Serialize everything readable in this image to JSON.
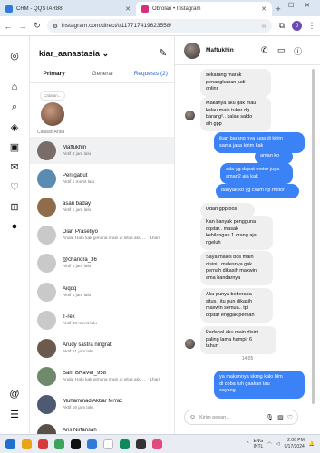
{
  "browser": {
    "tabs": [
      {
        "title": "CRM - QQSTAR88",
        "favicon_color": "#2f7bd9",
        "active": false
      },
      {
        "title": "Obrolan • Instagram",
        "favicon_color": "#d6307a",
        "active": true
      }
    ],
    "url": "instagram.com/direct/t/117717419623558/",
    "profile_initial": "J"
  },
  "inbox": {
    "username": "kiar_aanastasia",
    "tabs": {
      "primary": "Primary",
      "general": "General",
      "requests": "Requests (2)"
    },
    "note_bubble": "Catatan...",
    "note_label": "Catatan Anda",
    "conversations": [
      {
        "name": "Maftukhin",
        "status": "Aktif 4 jam lalu",
        "color": "#7a6d68",
        "active": true
      },
      {
        "name": "Peri gabut",
        "status": "Aktif 1 menit lalu",
        "color": "#5a8bb0"
      },
      {
        "name": "asan baday",
        "status": "Aktif 1 jam lalu",
        "color": "#8f6d4a"
      },
      {
        "name": "Dian Prasetiyo",
        "status": "Anda: Halo kak gimana main di situs aku ... · 1hari",
        "color": "#c9c9c9"
      },
      {
        "name": "@chandra_36",
        "status": "Aktif 1 jam lalu",
        "color": "#c9c9c9"
      },
      {
        "name": "Aiqqq",
        "status": "Aktif 1 jam lalu",
        "color": "#c9c9c9"
      },
      {
        "name": "T-rex",
        "status": "Aktif 38 menit lalu",
        "color": "#c9c9c9"
      },
      {
        "name": "Arudy sastra ningrat",
        "status": "Aktif 21 jam lalu",
        "color": "#6d5a4e"
      },
      {
        "name": "Sam BRaVer_958",
        "status": "Anda: Halo kak gimana main di situs aku ... · 1hari",
        "color": "#6f8a6a"
      },
      {
        "name": "Muhammad Akbar Mi'raz",
        "status": "Aktif 16 jam lalu",
        "color": "#4e5a72"
      },
      {
        "name": "Aris Nirfansah",
        "status": "Aktif 1 jam lalu",
        "color": "#5a4e48"
      }
    ]
  },
  "chat": {
    "name": "Maftukhin",
    "messages": [
      {
        "dir": "in",
        "lines": [
          "sekarang marak",
          "penangkapan judi",
          "onlinr"
        ]
      },
      {
        "dir": "in",
        "lines": [
          "Makanya aku gak mau",
          "kalau main tukar dg",
          "barang².. kalau saldo",
          "sih gpp"
        ]
      },
      {
        "dir": "out",
        "lines": [
          "ikan barang nya juga di kirim",
          "sama jasa kirim kak"
        ]
      },
      {
        "dir": "out",
        "lines": [
          "aman ko"
        ]
      },
      {
        "dir": "out",
        "lines": [
          "ada yg dapat motor juga",
          "aman2 aja kak"
        ]
      },
      {
        "dir": "out",
        "lines": [
          "banyak ko yg claim hp motor"
        ]
      },
      {
        "dir": "in",
        "lines": [
          "Udah gpp bos"
        ]
      },
      {
        "dir": "in",
        "lines": [
          "Kan banyak pengguna",
          "qqstar.. masak",
          "kehilangan 1 orang aja",
          "ngeluh"
        ]
      },
      {
        "dir": "in",
        "lines": [
          "Saya males bos main",
          "disini.. malesnya gak",
          "pernah dikasih maxwin",
          "ama bandarnya"
        ]
      },
      {
        "dir": "in",
        "lines": [
          "Aku punya beberapa",
          "situs.. itu pun dikasih",
          "maxwin semua.. tpi",
          "qqstar enggak pernah"
        ]
      },
      {
        "dir": "in",
        "lines": [
          "Padahal aku main disini",
          "paling lama hampir 6",
          "tahun"
        ]
      },
      {
        "dir": "out",
        "lines": [
          "ya makannya skrng kalo blm",
          "di coba tuh gaakan tau",
          "sayang"
        ]
      }
    ],
    "time_separator": "14.05",
    "composer_placeholder": "Kirim pesan..."
  },
  "taskbar": {
    "icons": [
      "#1f6fd1",
      "#e8a317",
      "#d63b3b",
      "#3ba55c",
      "#111111",
      "#2f7bd9",
      "#ffffff",
      "#0e8a5f",
      "#333333",
      "#e04a7c"
    ],
    "lang_top": "ENG",
    "lang_bottom": "INTL",
    "time": "2:06 PM",
    "date": "9/17/2024"
  },
  "colors": {
    "accent": "#3b82f6",
    "link": "#2b63d9"
  }
}
